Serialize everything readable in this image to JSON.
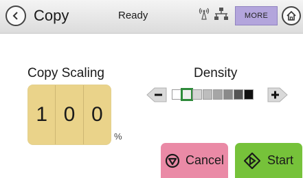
{
  "header": {
    "title": "Copy",
    "status": "Ready",
    "more_label": "MORE",
    "icons": [
      "back-icon",
      "wireless-icon",
      "network-icon",
      "home-icon"
    ]
  },
  "scaling": {
    "label": "Copy Scaling",
    "digits": [
      "1",
      "0",
      "0"
    ],
    "unit": "%"
  },
  "density": {
    "label": "Density",
    "levels": [
      "#ffffff",
      "#eeeeee",
      "#d4d4d4",
      "#bdbdbd",
      "#a6a6a6",
      "#8a8a8a",
      "#555555",
      "#111111"
    ],
    "selected_index": 1
  },
  "actions": {
    "cancel_label": "Cancel",
    "start_label": "Start"
  },
  "colors": {
    "more": "#b3a5dc",
    "scaling_box": "#ead38a",
    "cancel": "#ea8aa6",
    "start": "#76c23a",
    "selection": "#2e8a3a"
  }
}
